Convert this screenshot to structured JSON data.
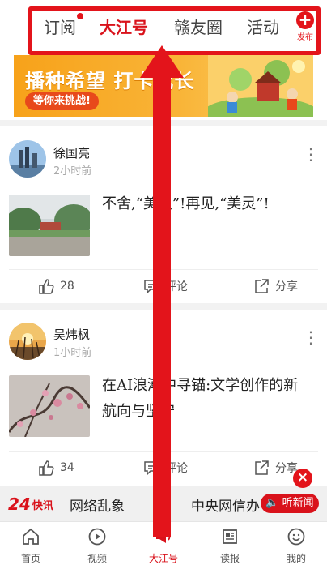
{
  "top_tabs": {
    "items": [
      "订阅",
      "大江号",
      "赣友圈",
      "活动"
    ],
    "active": "大江号",
    "publish_label": "发布"
  },
  "banner": {
    "title": "播种希望 打卡成长",
    "subtitle": "等你来挑战!"
  },
  "posts": [
    {
      "author": "徐国亮",
      "time": "2小时前",
      "headline": "不舍,“美灵”!再见,“美灵”!",
      "likes": "28",
      "comment_label": "评论",
      "share_label": "分享"
    },
    {
      "author": "吴炜枫",
      "time": "1小时前",
      "headline": "在AI浪潮中寻锚:文学创作的新航向与坚守",
      "likes": "34",
      "comment_label": "评论",
      "share_label": "分享"
    }
  ],
  "ticker": {
    "logo_number": "24",
    "logo_text": "快讯",
    "items": [
      "网络乱象",
      "中央网信办"
    ],
    "listen_label": "听新闻"
  },
  "bottom_nav": {
    "items": [
      "首页",
      "视频",
      "大江号",
      "读报",
      "我的"
    ],
    "active": "大江号"
  },
  "colors": {
    "brand_red": "#d9121b",
    "annotation_red": "#e3141b",
    "banner_orange": "#f7a21a"
  }
}
